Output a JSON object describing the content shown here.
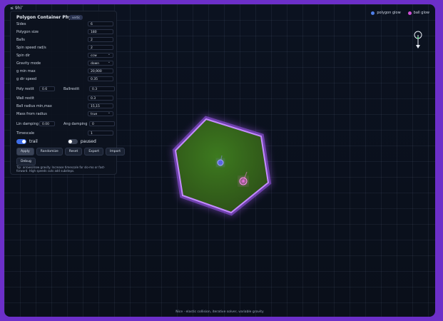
{
  "corner_label": "≤ 9hi″",
  "legend": {
    "items": [
      {
        "label": "polygon glow",
        "color": "#4f7fe8"
      },
      {
        "label": "ball glow",
        "color": "#cf4fd8"
      }
    ]
  },
  "panel": {
    "title": "Polygon Container Physics",
    "badge": "vertic",
    "fields": [
      {
        "label": "Sides",
        "value": "6"
      },
      {
        "label": "Polygon size",
        "value": "180"
      },
      {
        "label": "Balls",
        "value": "2"
      },
      {
        "label": "Spin speed rad/s",
        "value": "2"
      },
      {
        "label": "Spin dir",
        "value": "ccw"
      },
      {
        "label": "Gravity mode",
        "value": "down"
      },
      {
        "label": "g min max",
        "value": "20,900"
      },
      {
        "label": "g dir speed",
        "value": "0.35"
      }
    ],
    "restit": {
      "poly_label": "Poly restit",
      "poly_value": "0.6",
      "ball_label": "Ballrestit",
      "ball_value": "0.3"
    },
    "wall": {
      "label": "Wall restit",
      "value": "0.3"
    },
    "radius": {
      "label": "Ball radius min,max",
      "value": "15,15"
    },
    "mass": {
      "label": "Mass from radius",
      "value": "true"
    },
    "damping": {
      "lin_label": "Lin damping",
      "lin_value": "0.00",
      "ang_label": "Ang damping",
      "ang_value": "0"
    },
    "timescale": {
      "label": "Timescale",
      "value": "1"
    },
    "toggles": {
      "trail": "trail",
      "paused": "paused"
    },
    "buttons": {
      "apply": "Apply",
      "randomize": "Randomize",
      "reset": "Reset",
      "export": "Export",
      "import": "Import",
      "debug": "Debug"
    },
    "tip": "Tip: arrows/slow gravity. Increase timescale for slo-mo or fast-forward. High speeds cuts add substeps."
  },
  "footer": "Nice · elastic collision, iterative solver, variable gravity",
  "colors": {
    "accent": "#3f6ee8",
    "polygon_fill": "#3f7a1e",
    "polygon_glow": "#9b4fe8",
    "ball_blue": "#5a66e0",
    "ball_pink": "#d24fc8"
  }
}
